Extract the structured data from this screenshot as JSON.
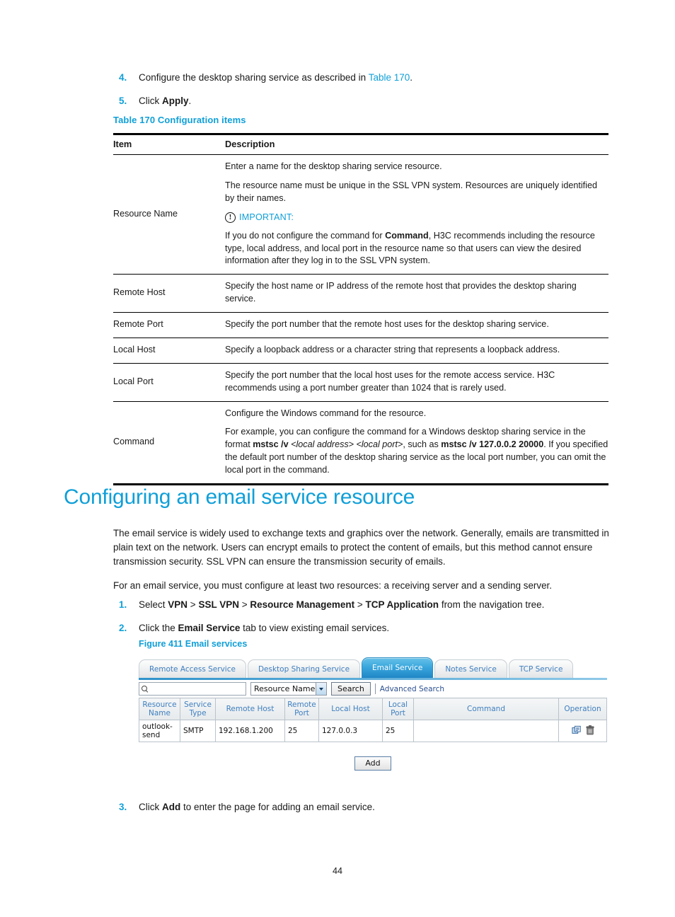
{
  "steps_top": [
    {
      "num": "4.",
      "text_before": "Configure the desktop sharing service as described in ",
      "link": "Table 170",
      "text_after": "."
    },
    {
      "num": "5.",
      "text_before": "Click ",
      "bold": "Apply",
      "text_after": "."
    }
  ],
  "table_caption": "Table 170 Configuration items",
  "config_table": {
    "headers": [
      "Item",
      "Description"
    ],
    "rows": [
      {
        "item": "Resource Name",
        "paragraphs": [
          "Enter a name for the desktop sharing service resource.",
          "The resource name must be unique in the SSL VPN system. Resources are uniquely identified by their names."
        ],
        "important_label": "IMPORTANT:",
        "important_icon": "exclamation-circle-icon",
        "important_parts": [
          {
            "t": "If you do not configure the command for "
          },
          {
            "t": "Command",
            "style": "bold"
          },
          {
            "t": ", H3C recommends including the resource type, local address, and local port in the resource name so that users can view the desired information after they log in to the SSL VPN system."
          }
        ]
      },
      {
        "item": "Remote Host",
        "paragraphs": [
          "Specify the host name or IP address of the remote host that provides the desktop sharing service."
        ]
      },
      {
        "item": "Remote Port",
        "paragraphs": [
          "Specify the port number that the remote host uses for the desktop sharing service."
        ]
      },
      {
        "item": "Local Host",
        "paragraphs": [
          "Specify a loopback address or a character string that represents a loopback address."
        ]
      },
      {
        "item": "Local Port",
        "paragraphs": [
          "Specify the port number that the local host uses for the remote access service. H3C recommends using a port number greater than 1024 that is rarely used."
        ]
      },
      {
        "item": "Command",
        "paragraphs": [
          "Configure the Windows command for the resource."
        ],
        "rich_parts": [
          {
            "t": "For example, you can configure the command for a Windows desktop sharing service in the format "
          },
          {
            "t": "mstsc /v",
            "style": "bold"
          },
          {
            "t": " "
          },
          {
            "t": "<local address> <local port>",
            "style": "italic"
          },
          {
            "t": ", such as "
          },
          {
            "t": "mstsc /v 127.0.0.2 20000",
            "style": "bold"
          },
          {
            "t": ". If you specified the default port number of the desktop sharing service as the local port number, you can omit the local port in the command."
          }
        ]
      }
    ]
  },
  "section": {
    "heading": "Configuring an email service resource",
    "paragraphs": [
      "The email service is widely used to exchange texts and graphics over the network. Generally, emails are transmitted in plain text on the network. Users can encrypt emails to protect the content of emails, but this method cannot ensure transmission security. SSL VPN can ensure the transmission security of emails.",
      "For an email service, you must configure at least two resources: a receiving server and a sending server."
    ]
  },
  "steps_mid": [
    {
      "num": "1.",
      "parts": [
        {
          "t": "Select "
        },
        {
          "t": "VPN",
          "style": "bold"
        },
        {
          "t": " > "
        },
        {
          "t": "SSL VPN",
          "style": "bold"
        },
        {
          "t": " > "
        },
        {
          "t": "Resource Management",
          "style": "bold"
        },
        {
          "t": " > "
        },
        {
          "t": "TCP Application",
          "style": "bold"
        },
        {
          "t": " from the navigation tree."
        }
      ]
    },
    {
      "num": "2.",
      "parts": [
        {
          "t": "Click the "
        },
        {
          "t": "Email Service",
          "style": "bold"
        },
        {
          "t": " tab to view existing email services."
        }
      ]
    }
  ],
  "figure_caption": "Figure 411 Email services",
  "screenshot": {
    "tabs": [
      {
        "label": "Remote Access Service",
        "active": false
      },
      {
        "label": "Desktop Sharing Service",
        "active": false
      },
      {
        "label": "Email Service",
        "active": true
      },
      {
        "label": "Notes Service",
        "active": false
      },
      {
        "label": "TCP Service",
        "active": false
      }
    ],
    "search": {
      "icon": "magnifier-icon",
      "input_value": "",
      "placeholder": "",
      "select_value": "Resource Name",
      "select_options": [
        "Resource Name"
      ],
      "search_button": "Search",
      "advanced_link": "Advanced Search"
    },
    "grid": {
      "headers": [
        "Resource Name",
        "Service Type",
        "Remote Host",
        "Remote Port",
        "Local Host",
        "Local Port",
        "Command",
        "Operation"
      ],
      "rows": [
        {
          "resource_name": "outlook-send",
          "service_type": "SMTP",
          "remote_host": "192.168.1.200",
          "remote_port": "25",
          "local_host": "127.0.0.3",
          "local_port": "25",
          "command": "",
          "operations": [
            "edit-icon",
            "delete-icon"
          ]
        }
      ]
    },
    "add_button": "Add"
  },
  "steps_bottom": [
    {
      "num": "3.",
      "parts": [
        {
          "t": "Click "
        },
        {
          "t": "Add",
          "style": "bold"
        },
        {
          "t": " to enter the page for adding an email service."
        }
      ]
    }
  ],
  "page_number": "44",
  "colors": {
    "accent": "#0f9fd8",
    "tab_active_start": "#68c2e8",
    "tab_active_end": "#1f86c6",
    "grid_header_text": "#3f7fbf",
    "link": "#2b4f8e"
  }
}
